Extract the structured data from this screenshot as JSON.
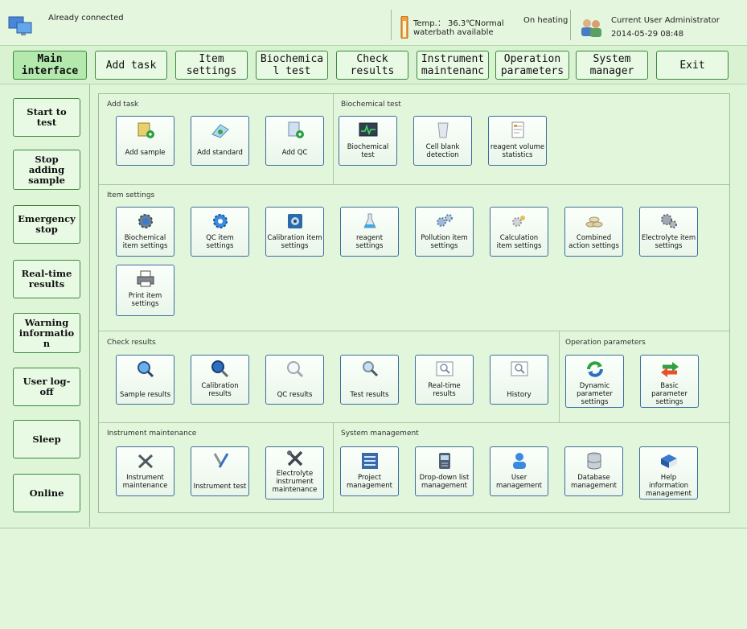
{
  "status": {
    "connection": "Already connected",
    "temp_line1": "Temp.： 36.3℃Normal",
    "temp_line2": "waterbath  available",
    "heating": "On heating",
    "current_user": "Current User  Administrator",
    "datetime": "2014-05-29 08:48"
  },
  "menu": [
    {
      "label": "Main\ninterface",
      "active": true
    },
    {
      "label": "Add task"
    },
    {
      "label": "Item\nsettings"
    },
    {
      "label": "Biochemica\nl test"
    },
    {
      "label": "Check\nresults"
    },
    {
      "label": "Instrument\nmaintenanc"
    },
    {
      "label": "Operation\nparameters"
    },
    {
      "label": "System\nmanager"
    },
    {
      "label": "Exit"
    }
  ],
  "sidebar": [
    {
      "label": "Start to\ntest"
    },
    {
      "label": "Stop\nadding\nsample"
    },
    {
      "label": "Emergency\nstop"
    },
    {
      "label": "Real-time\nresults"
    },
    {
      "label": "Warning\ninformatio\nn"
    },
    {
      "label": "User log-\noff"
    },
    {
      "label": "Sleep"
    },
    {
      "label": "Online"
    }
  ],
  "sections": {
    "add_task": {
      "title": "Add task",
      "tiles": [
        {
          "label": "Add sample",
          "icon": "add-sample-icon"
        },
        {
          "label": "Add standard",
          "icon": "add-standard-icon"
        },
        {
          "label": "Add QC",
          "icon": "add-qc-icon"
        }
      ]
    },
    "biochemical_test": {
      "title": "Biochemical test",
      "tiles": [
        {
          "label": "Biochemical\ntest",
          "icon": "monitor-icon"
        },
        {
          "label": "Cell blank\ndetection",
          "icon": "cup-icon"
        },
        {
          "label": "reagent volume\nstatistics",
          "icon": "document-icon"
        }
      ]
    },
    "item_settings": {
      "title": "Item settings",
      "tiles": [
        {
          "label": "Biochemical\nitem settings",
          "icon": "gear-icon"
        },
        {
          "label": "QC item\nsettings",
          "icon": "gear-blue-icon"
        },
        {
          "label": "Calibration item\nsettings",
          "icon": "calibration-icon"
        },
        {
          "label": "reagent\nsettings",
          "icon": "flask-icon"
        },
        {
          "label": "Pollution item\nsettings",
          "icon": "gears-icon"
        },
        {
          "label": "Calculation\nitem settings",
          "icon": "calc-icon"
        },
        {
          "label": "Combined\naction settings",
          "icon": "coins-icon"
        },
        {
          "label": "Electrolyte item\nsettings",
          "icon": "tools-icon"
        },
        {
          "label": "Print item\nsettings",
          "icon": "printer-icon"
        }
      ]
    },
    "check_results": {
      "title": "Check results",
      "tiles": [
        {
          "label": "Sample results",
          "icon": "search-icon"
        },
        {
          "label": "Calibration\nresults",
          "icon": "search-dark-icon"
        },
        {
          "label": "QC results",
          "icon": "search-light-icon"
        },
        {
          "label": "Test results",
          "icon": "search-icon"
        },
        {
          "label": "Real-time\nresults",
          "icon": "search-box-icon"
        },
        {
          "label": "History",
          "icon": "search-box-icon"
        }
      ]
    },
    "operation_parameters": {
      "title": "Operation parameters",
      "tiles": [
        {
          "label": "Dynamic\nparameter\nsettings",
          "icon": "refresh-icon"
        },
        {
          "label": "Basic\nparameter\nsettings",
          "icon": "swap-icon"
        }
      ]
    },
    "instrument_maintenance": {
      "title": "Instrument maintenance",
      "tiles": [
        {
          "label": "Instrument\nmaintenance",
          "icon": "wrench-icon"
        },
        {
          "label": "Instrument test",
          "icon": "pen-icon"
        },
        {
          "label": "Electrolyte\ninstrument\nmaintenance",
          "icon": "tools-icon"
        }
      ]
    },
    "system_management": {
      "title": "System management",
      "tiles": [
        {
          "label": "Project\nmanagement",
          "icon": "list-icon"
        },
        {
          "label": "Drop-down list\nmanagement",
          "icon": "dropdown-icon"
        },
        {
          "label": "User\nmanagement",
          "icon": "user-icon"
        },
        {
          "label": "Database\nmanagement",
          "icon": "database-icon"
        },
        {
          "label": "Help\ninformation\nmanagement",
          "icon": "book-icon"
        }
      ]
    }
  }
}
